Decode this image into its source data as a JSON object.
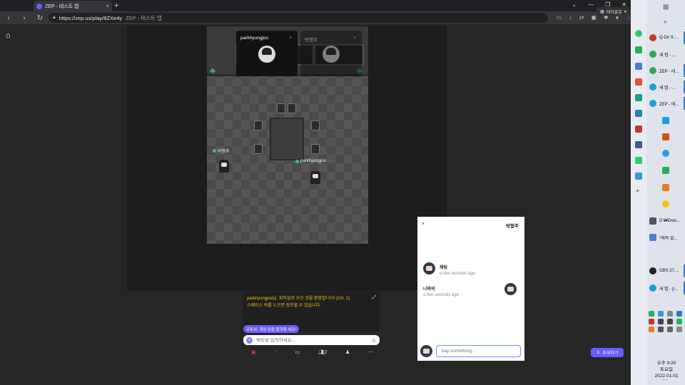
{
  "browser": {
    "tab_title": "ZEP - 테스트 맵",
    "url_host": "https://zep.us/play/8ZXe4y",
    "url_suffix": "ZEP - 테스트 맵",
    "new_tab": "+"
  },
  "video_tiles": [
    {
      "name": "parkhyungjoo"
    },
    {
      "name": "박형주"
    }
  ],
  "map_select_label": "테이블뷰",
  "map": {
    "players": [
      {
        "name": "박형주"
      },
      {
        "name": "parkhyungjoo"
      }
    ]
  },
  "chat": {
    "messages": [
      "parkhyungjoo님, 회의실로 오신 것을 환영합니다! (CH. 1)",
      "스페이스 바를 누르면 점프할 수 있습니다."
    ],
    "hint": "유튜브, 게임 링을 즐겨찾 세요!",
    "placeholder": "채팅을 입력하세요..."
  },
  "bottom_bar": {
    "participants_count": "2"
  },
  "panel": {
    "close": "×",
    "title": "박형주",
    "messages": [
      {
        "name": "채팅",
        "time": "a few seconds ago"
      },
      {
        "name": "나와의",
        "time": "a few seconds ago"
      }
    ],
    "input_placeholder": "Say something..."
  },
  "invite_button": "초대하기",
  "taskbar": {
    "items": [
      {
        "label": "Q-Dir 9....",
        "color": "#c0392b"
      },
      {
        "label": "새 탭 - ...",
        "color": "#34a853"
      },
      {
        "label": "ZEP - 테...",
        "color": "#34a853"
      },
      {
        "label": "새 탭 - ...",
        "color": "#1a9fd9"
      },
      {
        "label": "ZEP - 테...",
        "color": "#1a9fd9"
      },
      {
        "label": "D:₩Dow...",
        "color": "#555"
      },
      {
        "label": "*제목 없...",
        "color": "#4a7fd1"
      },
      {
        "label": "OBS 27....",
        "color": "#222"
      },
      {
        "label": "새 탭 - [I...",
        "color": "#1a9fd9"
      }
    ],
    "clock_time": "오후 9:20",
    "clock_day": "토요일",
    "clock_date": "2022-01-01"
  }
}
